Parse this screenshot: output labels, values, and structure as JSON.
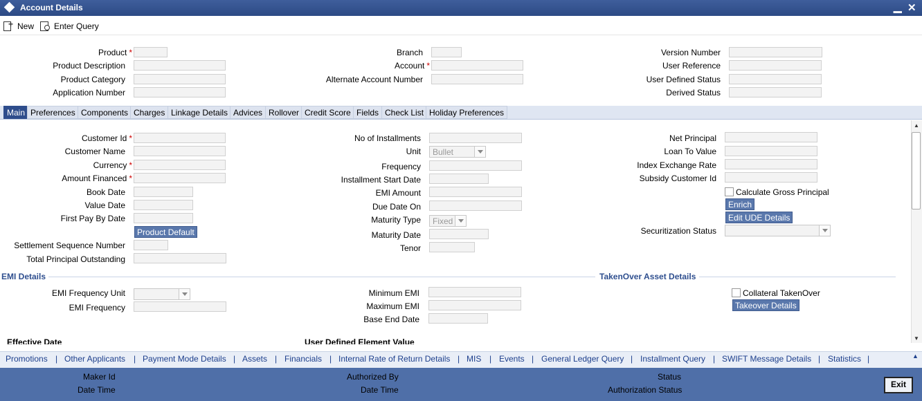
{
  "window": {
    "title": "Account Details",
    "minimize": "▁",
    "close": "✕"
  },
  "toolbar": {
    "new_label": "New",
    "enter_query_label": "Enter Query"
  },
  "header": {
    "product": "Product",
    "product_description": "Product Description",
    "product_category": "Product Category",
    "application_number": "Application Number",
    "branch": "Branch",
    "account": "Account",
    "alternate_account_number": "Alternate Account Number",
    "version_number": "Version Number",
    "user_reference": "User Reference",
    "user_defined_status": "User Defined Status",
    "derived_status": "Derived Status"
  },
  "required_marker": "*",
  "tabs": [
    "Main",
    "Preferences",
    "Components",
    "Charges",
    "Linkage Details",
    "Advices",
    "Rollover",
    "Credit Score",
    "Fields",
    "Check List",
    "Holiday Preferences"
  ],
  "main": {
    "customer_id": "Customer Id",
    "customer_name": "Customer Name",
    "currency": "Currency",
    "amount_financed": "Amount Financed",
    "book_date": "Book Date",
    "value_date": "Value Date",
    "first_pay_by_date": "First Pay By Date",
    "product_default_button": "Product Default",
    "settlement_sequence_number": "Settlement Sequence Number",
    "total_principal_outstanding": "Total Principal Outstanding",
    "no_of_installments": "No of Installments",
    "unit": "Unit",
    "unit_value": "Bullet",
    "frequency": "Frequency",
    "installment_start_date": "Installment Start Date",
    "emi_amount": "EMI Amount",
    "due_date_on": "Due Date On",
    "maturity_type": "Maturity Type",
    "maturity_type_value": "Fixed",
    "maturity_date": "Maturity Date",
    "tenor": "Tenor",
    "net_principal": "Net Principal",
    "loan_to_value": "Loan To Value",
    "index_exchange_rate": "Index Exchange Rate",
    "subsidy_customer_id": "Subsidy Customer Id",
    "calculate_gross_principal": "Calculate Gross Principal",
    "enrich_button": "Enrich",
    "edit_ude_button": "Edit UDE Details",
    "securitization_status": "Securitization Status"
  },
  "emi": {
    "section_title": "EMI Details",
    "emi_frequency_unit": "EMI Frequency Unit",
    "emi_frequency": "EMI Frequency",
    "minimum_emi": "Minimum EMI",
    "maximum_emi": "Maximum EMI",
    "base_end_date": "Base End Date"
  },
  "takenover": {
    "section_title": "TakenOver Asset Details",
    "collateral_takenover": "Collateral TakenOver",
    "takeover_details_button": "Takeover Details"
  },
  "partial": {
    "effective_date": "Effective Date",
    "user_defined_element_value": "User Defined Element Value"
  },
  "links": [
    "Promotions",
    "Other Applicants",
    "Payment Mode Details",
    "Assets",
    "Financials",
    "Internal Rate of Return Details",
    "MIS",
    "Events",
    "General Ledger Query",
    "Installment Query",
    "SWIFT Message Details",
    "Statistics"
  ],
  "link_separator": "|",
  "footer": {
    "maker_id": "Maker Id",
    "date_time": "Date Time",
    "authorized_by": "Authorized By",
    "status": "Status",
    "authorization_status": "Authorization Status",
    "exit_button": "Exit"
  }
}
